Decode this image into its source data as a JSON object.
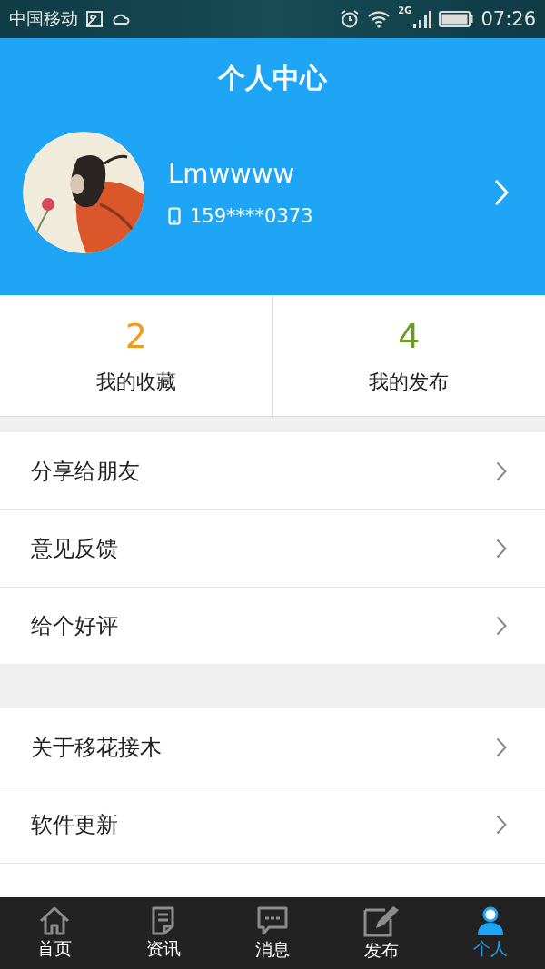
{
  "status_bar": {
    "carrier": "中国移动",
    "network": "2G",
    "time": "07:26"
  },
  "header": {
    "title": "个人中心"
  },
  "profile": {
    "name": "Lmwwww",
    "phone": "159****0373"
  },
  "stats": [
    {
      "value": "2",
      "label": "我的收藏",
      "color": "#f39a1e"
    },
    {
      "value": "4",
      "label": "我的发布",
      "color": "#6a9a1f"
    }
  ],
  "menu_groups": [
    [
      {
        "label": "分享给朋友"
      },
      {
        "label": "意见反馈"
      },
      {
        "label": "给个好评"
      }
    ],
    [
      {
        "label": "关于移花接木"
      },
      {
        "label": "软件更新"
      }
    ]
  ],
  "bottom_nav": [
    {
      "label": "首页",
      "kind": "home",
      "selected": false
    },
    {
      "label": "资讯",
      "kind": "news",
      "selected": false
    },
    {
      "label": "消息",
      "kind": "message",
      "selected": false
    },
    {
      "label": "发布",
      "kind": "publish",
      "selected": false
    },
    {
      "label": "个人",
      "kind": "person",
      "selected": true
    }
  ]
}
